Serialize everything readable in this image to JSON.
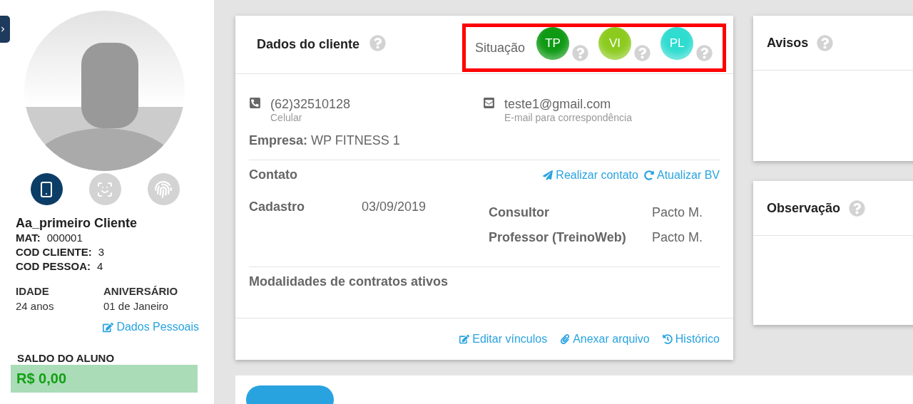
{
  "sidebar": {
    "access_icons": [
      {
        "kind": "phone",
        "active": true
      },
      {
        "kind": "face",
        "active": false
      },
      {
        "kind": "fingerprint",
        "active": false
      }
    ],
    "name": "Aa_primeiro Cliente",
    "ids": [
      {
        "label": "MAT:",
        "value": "000001"
      },
      {
        "label": "COD CLIENTE:",
        "value": "3"
      },
      {
        "label": "COD PESSOA:",
        "value": "4"
      }
    ],
    "facts": [
      {
        "label": "IDADE",
        "value": "24 anos"
      },
      {
        "label": "ANIVERSÁRIO",
        "value": "01 de Janeiro"
      }
    ],
    "personal_link": "Dados Pessoais",
    "balance": {
      "label": "SALDO DO ALUNO",
      "value": "R$ 0,00"
    }
  },
  "client_card": {
    "title": "Dados do cliente",
    "status_label": "Situação",
    "statuses": [
      {
        "label": "TP",
        "color": "#0f9a14"
      },
      {
        "label": "VI",
        "color": "#8ccb1e"
      },
      {
        "label": "PL",
        "color": "#2fdcd0"
      }
    ],
    "phone": {
      "value": "(62)32510128",
      "caption": "Celular"
    },
    "email": {
      "value": "teste1@gmail.com",
      "caption": "E-mail para correspondência"
    },
    "company": {
      "label": "Empresa:",
      "value": "WP FITNESS 1"
    },
    "contact": {
      "title": "Contato",
      "actions": [
        {
          "kind": "send",
          "label": "Realizar contato"
        },
        {
          "kind": "refresh",
          "label": "Atualizar BV"
        }
      ]
    },
    "registration": {
      "label": "Cadastro",
      "value": "03/09/2019"
    },
    "staff": [
      {
        "label": "Consultor",
        "value": "Pacto M."
      },
      {
        "label": "Professor (TreinoWeb)",
        "value": "Pacto M."
      }
    ],
    "contracts_title": "Modalidades de contratos ativos",
    "footer_actions": [
      {
        "kind": "edit",
        "label": "Editar vínculos"
      },
      {
        "kind": "clip",
        "label": "Anexar arquivo"
      },
      {
        "kind": "history",
        "label": "Histórico"
      }
    ]
  },
  "side_cards": [
    {
      "title": "Avisos"
    },
    {
      "title": "Observação"
    }
  ]
}
